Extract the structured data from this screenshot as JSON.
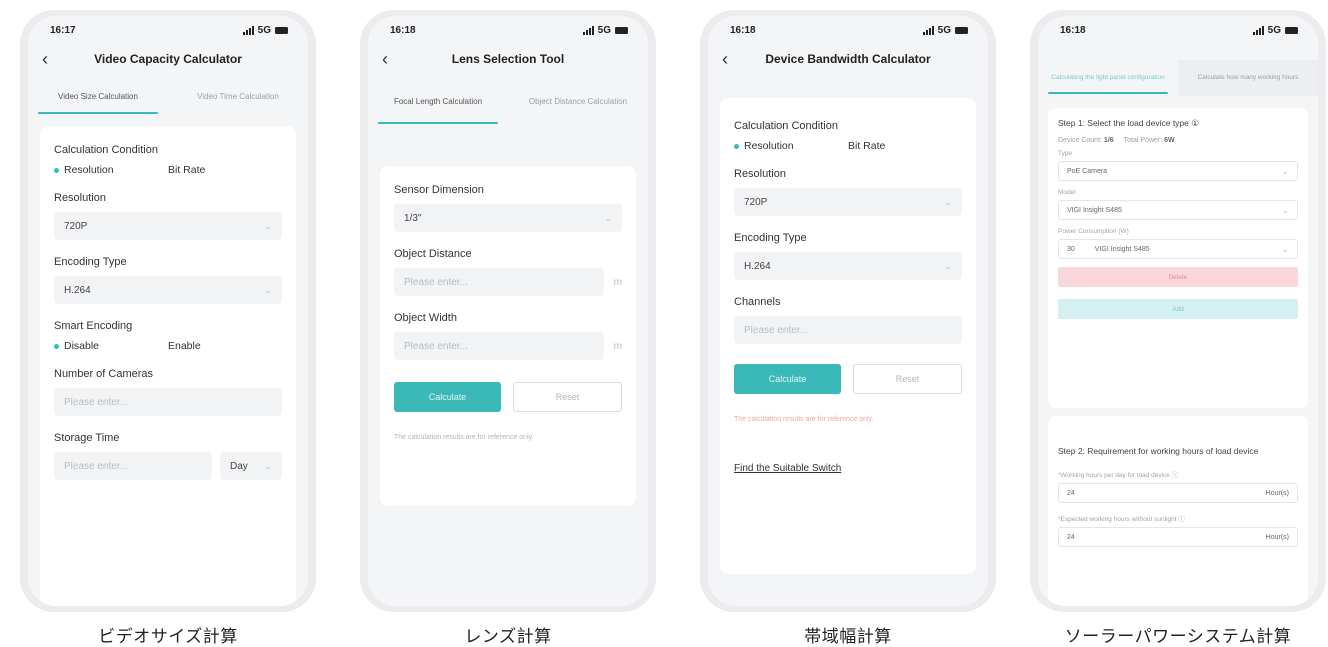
{
  "phones": [
    {
      "time": "16:17",
      "status_right": "5G",
      "title": "Video Capacity Calculator",
      "tabs": [
        "Video Size Calculation",
        "Video Time Calculation"
      ],
      "calc_condition_label": "Calculation Condition",
      "calc_options": [
        "Resolution",
        "Bit Rate"
      ],
      "resolution_label": "Resolution",
      "resolution_value": "720P",
      "encoding_label": "Encoding Type",
      "encoding_value": "H.264",
      "smart_encoding_label": "Smart Encoding",
      "smart_options": [
        "Disable",
        "Enable"
      ],
      "cameras_label": "Number of Cameras",
      "cameras_placeholder": "Please enter...",
      "storage_label": "Storage Time",
      "storage_placeholder": "Please enter...",
      "storage_unit": "Day",
      "caption": "ビデオサイズ計算"
    },
    {
      "time": "16:18",
      "status_right": "5G",
      "title": "Lens Selection Tool",
      "tabs": [
        "Focal Length Calculation",
        "Object Distance Calculation"
      ],
      "sensor_label": "Sensor Dimension",
      "sensor_value": "1/3\"",
      "distance_label": "Object Distance",
      "distance_placeholder": "Please enter...",
      "distance_unit": "m",
      "width_label": "Object Width",
      "width_placeholder": "Please enter...",
      "width_unit": "m",
      "calculate": "Calculate",
      "reset": "Reset",
      "note": "The calculation results are for reference only.",
      "caption": "レンズ計算"
    },
    {
      "time": "16:18",
      "status_right": "5G",
      "title": "Device Bandwidth Calculator",
      "calc_condition_label": "Calculation Condition",
      "calc_options": [
        "Resolution",
        "Bit Rate"
      ],
      "resolution_label": "Resolution",
      "resolution_value": "720P",
      "encoding_label": "Encoding Type",
      "encoding_value": "H.264",
      "channels_label": "Channels",
      "channels_placeholder": "Please enter...",
      "calculate": "Calculate",
      "reset": "Reset",
      "note": "The calculation results are for reference only.",
      "link": "Find the Suitable Switch",
      "caption": "帯域幅計算"
    },
    {
      "time": "16:18",
      "status_right": "5G",
      "tabs": [
        "Calculating the light panel configuration",
        "Calculate how many working hours"
      ],
      "step1_title": "Step 1: Select the load device type ①",
      "device_count_label": "Device Count:",
      "device_count": "1/6",
      "total_power_label": "Total Power:",
      "total_power": "6W",
      "type_label": "Type",
      "type_value": "PoE Camera",
      "model_label": "Model",
      "model_value": "VIGI Insight S485",
      "power_label": "Power Consumption (W)",
      "power_value": "30",
      "power_model": "VIGI Insight S485",
      "delete": "Delete",
      "add": "Add",
      "step2_title": "Step 2: Requirement for working hours of load device",
      "working_hours_label": "*Working hours per day for load device ⓘ",
      "working_hours_value": "24",
      "working_hours_unit": "Hour(s)",
      "expected_hours_label": "*Expected working hours without sunlight ⓘ",
      "expected_hours_value": "24",
      "expected_hours_unit": "Hour(s)",
      "caption": "ソーラーパワーシステム計算"
    }
  ]
}
